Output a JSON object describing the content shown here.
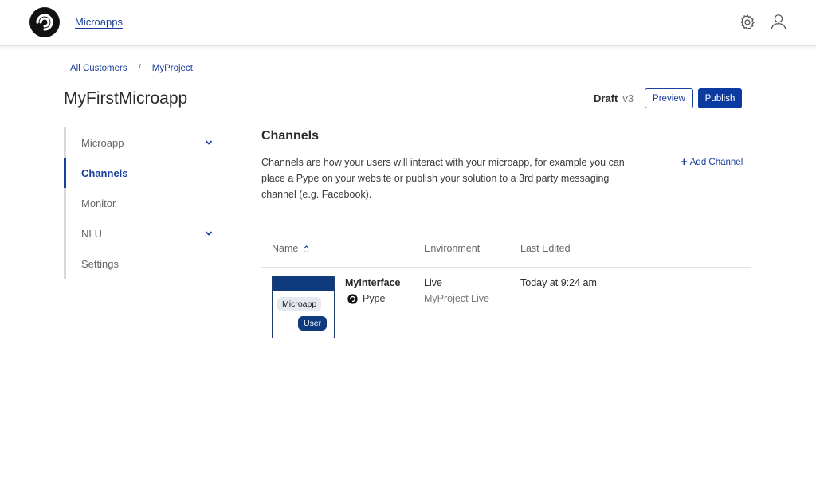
{
  "header": {
    "app_link": "Microapps",
    "icons": {
      "logo": "pype-logo-icon",
      "settings": "gear-icon",
      "profile": "user-icon"
    }
  },
  "breadcrumb": {
    "items": [
      "All Customers",
      "MyProject"
    ],
    "separator": "/"
  },
  "page": {
    "title": "MyFirstMicroapp",
    "status": "Draft",
    "version": "v3",
    "preview_label": "Preview",
    "publish_label": "Publish"
  },
  "sidebar": {
    "items": [
      {
        "label": "Microapp",
        "expandable": true,
        "active": false
      },
      {
        "label": "Channels",
        "expandable": false,
        "active": true
      },
      {
        "label": "Monitor",
        "expandable": false,
        "active": false
      },
      {
        "label": "NLU",
        "expandable": true,
        "active": false
      },
      {
        "label": "Settings",
        "expandable": false,
        "active": false
      }
    ]
  },
  "channels": {
    "title": "Channels",
    "description": "Channels are how your users will interact with your microapp, for example you can place a Pype on your website or publish your solution to a 3rd party messaging channel (e.g. Facebook).",
    "add_label": "Add Channel",
    "columns": {
      "name": "Name",
      "environment": "Environment",
      "last_edited": "Last Edited"
    },
    "rows": [
      {
        "thumb_app": "Microapp",
        "thumb_user": "User",
        "name": "MyInterface",
        "type": "Pype",
        "environment": "Live",
        "environment_sub": "MyProject Live",
        "last_edited": "Today at 9:24 am"
      }
    ]
  },
  "colors": {
    "accent": "#1a3f9c",
    "primary_button": "#0b3aa0",
    "thumb_header": "#0e3a7e"
  }
}
